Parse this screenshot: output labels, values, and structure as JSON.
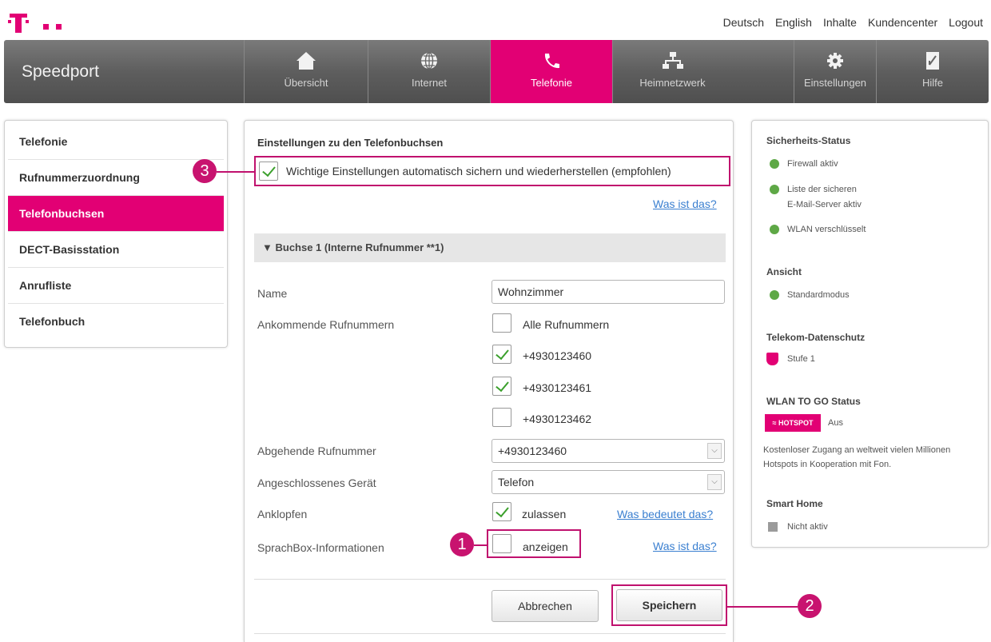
{
  "header": {
    "brand": "Speedport",
    "top_links": [
      "Deutsch",
      "English",
      "Inhalte",
      "Kundencenter",
      "Logout"
    ],
    "nav": [
      {
        "label": "Übersicht",
        "icon": "home-icon"
      },
      {
        "label": "Internet",
        "icon": "globe-icon"
      },
      {
        "label": "Telefonie",
        "icon": "phone-icon",
        "active": true
      },
      {
        "label": "Heimnetzwerk",
        "icon": "network-icon"
      },
      {
        "label": "Einstellungen",
        "icon": "gear-icon"
      },
      {
        "label": "Hilfe",
        "icon": "help-icon"
      }
    ]
  },
  "sidebar": {
    "items": [
      {
        "label": "Telefonie"
      },
      {
        "label": "Rufnummerzuordnung"
      },
      {
        "label": "Telefonbuchsen",
        "active": true
      },
      {
        "label": "DECT-Basisstation"
      },
      {
        "label": "Anrufliste"
      },
      {
        "label": "Telefonbuch"
      }
    ]
  },
  "main": {
    "section_title": "Einstellungen zu den Telefonbuchsen",
    "auto_save_label": "Wichtige Einstellungen automatisch sichern und wiederherstellen (empfohlen)",
    "auto_save_checked": true,
    "was_ist_das": "Was ist das?",
    "accordion": "Buchse 1 (Interne Rufnummer **1)",
    "name_label": "Name",
    "name_value": "Wohnzimmer",
    "incoming_label": "Ankommende Rufnummern",
    "incoming": [
      {
        "label": "Alle Rufnummern",
        "checked": false
      },
      {
        "label": "+4930123460",
        "checked": true
      },
      {
        "label": "+4930123461",
        "checked": true
      },
      {
        "label": "+4930123462",
        "checked": false
      }
    ],
    "outgoing_label": "Abgehende Rufnummer",
    "outgoing_value": "+4930123460",
    "device_label": "Angeschlossenes Gerät",
    "device_value": "Telefon",
    "anklopfen_label": "Anklopfen",
    "anklopfen_option": "zulassen",
    "anklopfen_checked": true,
    "anklopfen_help": "Was bedeutet das?",
    "sprachbox_label": "SprachBox-Informationen",
    "sprachbox_option": "anzeigen",
    "sprachbox_checked": false,
    "sprachbox_help": "Was ist das?",
    "cancel": "Abbrechen",
    "save": "Speichern"
  },
  "status_panel": {
    "security_title": "Sicherheits-Status",
    "firewall": "Firewall aktiv",
    "mail_line1": "Liste der sicheren",
    "mail_line2": "E-Mail-Server aktiv",
    "wlan": "WLAN verschlüsselt",
    "view_title": "Ansicht",
    "view_mode": "Standardmodus",
    "privacy_title": "Telekom-Datenschutz",
    "privacy_level": "Stufe 1",
    "wlantogo_title": "WLAN TO GO Status",
    "hotspot_badge": "HOTSPOT",
    "hotspot_state": "Aus",
    "hotspot_desc": "Kostenloser Zugang an weltweit vielen Millionen Hotspots in Kooperation mit Fon.",
    "smarthome_title": "Smart Home",
    "smarthome_state": "Nicht aktiv"
  },
  "markers": [
    "1",
    "2",
    "3"
  ],
  "colors": {
    "magenta": "#e20074",
    "nav_gray": "#5e5e5e",
    "check_green": "#3ba02c",
    "status_green": "#5ea846",
    "link_blue": "#3a7fd0"
  }
}
